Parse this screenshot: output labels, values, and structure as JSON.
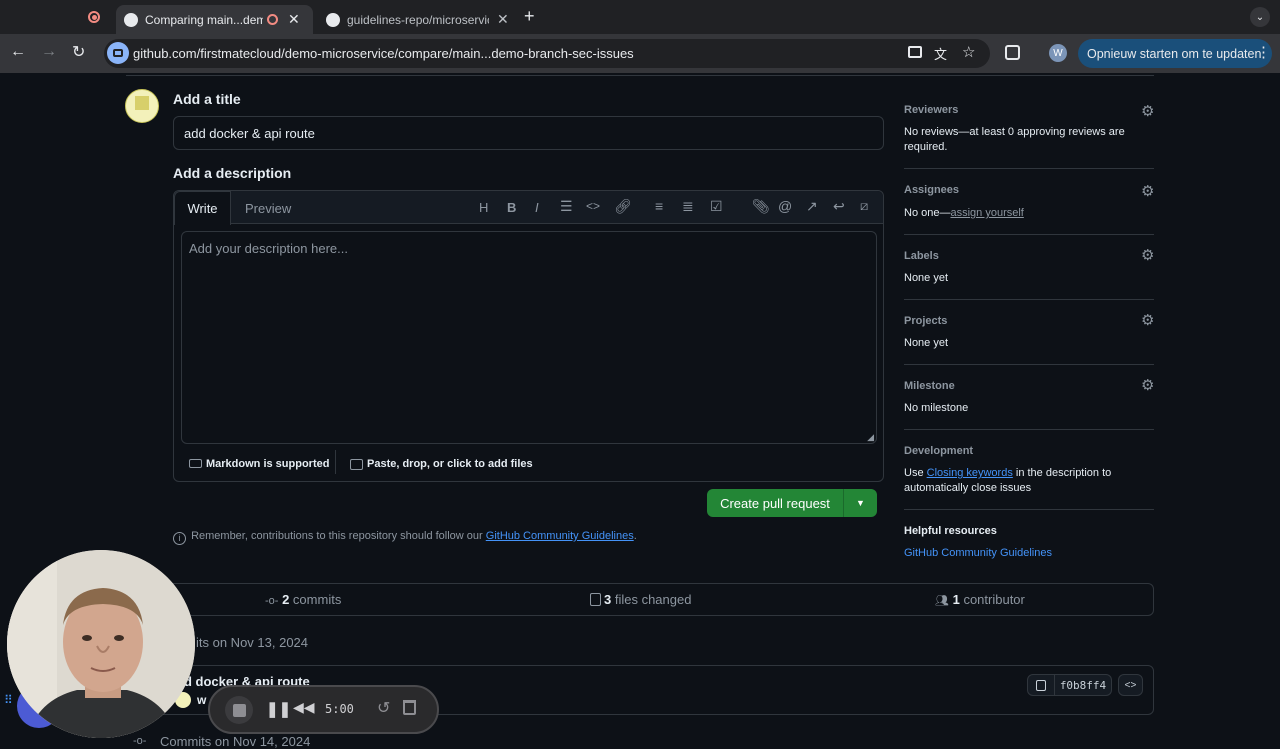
{
  "browser": {
    "tabs": [
      {
        "title": "Comparing main...demo-b"
      },
      {
        "title": "guidelines-repo/microservice"
      }
    ],
    "url": "github.com/firstmatecloud/demo-microservice/compare/main...demo-branch-sec-issues",
    "profile_initial": "W",
    "update_button": "Opnieuw starten om te updaten"
  },
  "form": {
    "title_label": "Add a title",
    "title_value": "add docker & api route",
    "description_label": "Add a description",
    "tab_write": "Write",
    "tab_preview": "Preview",
    "description_placeholder": "Add your description here...",
    "markdown_note": "Markdown is supported",
    "attach_note": "Paste, drop, or click to add files",
    "create_button": "Create pull request",
    "reminder_prefix": "Remember, contributions to this repository should follow our ",
    "reminder_link": "GitHub Community Guidelines",
    "reminder_suffix": "."
  },
  "sidebar": {
    "reviewers": {
      "title": "Reviewers",
      "value": "No reviews—at least 0 approving reviews are required."
    },
    "assignees": {
      "title": "Assignees",
      "value_prefix": "No one—",
      "link": "assign yourself"
    },
    "labels": {
      "title": "Labels",
      "value": "None yet"
    },
    "projects": {
      "title": "Projects",
      "value": "None yet"
    },
    "milestone": {
      "title": "Milestone",
      "value": "No milestone"
    },
    "development": {
      "title": "Development",
      "prefix": "Use ",
      "link": "Closing keywords",
      "suffix": " in the description to automatically close issues"
    },
    "helpful": {
      "title": "Helpful resources",
      "link": "GitHub Community Guidelines"
    }
  },
  "stats": {
    "commits_count": "2",
    "commits_label": " commits",
    "files_count": "3",
    "files_label": " files changed",
    "contributors_count": "1",
    "contributors_label": " contributor"
  },
  "commits": {
    "group1": "its on Nov 13, 2024",
    "commit_title": "d docker & api route",
    "author": "w",
    "sha": "f0b8ff4",
    "group2": "Commits on Nov 14, 2024"
  },
  "recorder": {
    "time": "5:00"
  },
  "colors": {
    "accent_green": "#238636",
    "link_blue": "#4493f8",
    "update_btn": "#1a4f7a"
  }
}
